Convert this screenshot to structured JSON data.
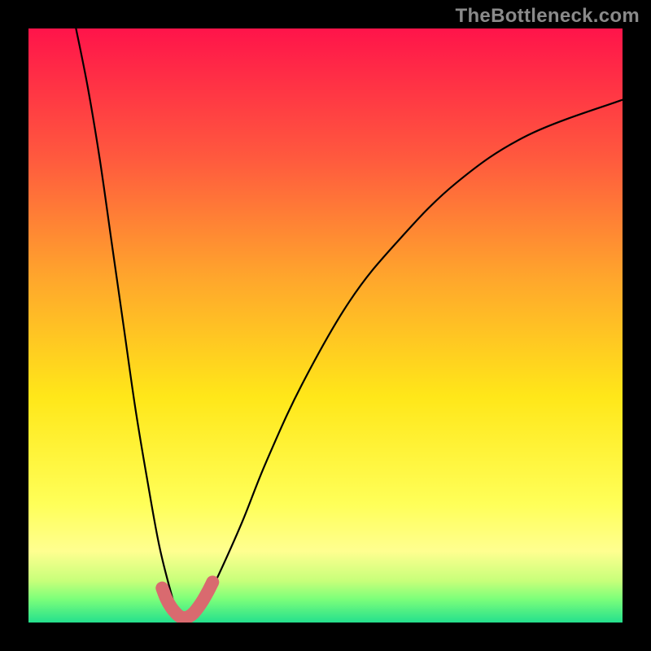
{
  "watermark": {
    "text": "TheBottleneck.com"
  },
  "chart_data": {
    "type": "line",
    "title": "",
    "xlabel": "",
    "ylabel": "",
    "xlim": [
      0,
      100
    ],
    "ylim": [
      0,
      100
    ],
    "series": [
      {
        "name": "bottleneck-curve",
        "x": [
          8,
          10,
          12,
          14,
          16,
          18,
          20,
          22,
          24,
          25,
          26,
          27,
          28,
          29,
          30,
          32,
          36,
          40,
          46,
          54,
          62,
          72,
          84,
          100
        ],
        "y": [
          100,
          90,
          78,
          64,
          50,
          36,
          24,
          13,
          5,
          2,
          1,
          0.5,
          1,
          2,
          4,
          8,
          17,
          27,
          40,
          54,
          64,
          74,
          82,
          88
        ]
      },
      {
        "name": "bottom-marker",
        "x": [
          22.5,
          23.2,
          24.0,
          24.8,
          25.5,
          26.2,
          27.0,
          27.8,
          28.6,
          29.4,
          30.2,
          31.0
        ],
        "y": [
          5.8,
          4.0,
          2.6,
          1.6,
          1.0,
          0.8,
          1.0,
          1.6,
          2.6,
          3.8,
          5.2,
          6.8
        ],
        "style": "thick-red"
      }
    ],
    "background_gradient": [
      "#ff144a",
      "#ff5a3e",
      "#ffa62c",
      "#ffe719",
      "#ffff58",
      "#ffff90",
      "#c7ff7a",
      "#7dff7a",
      "#24e08d"
    ]
  }
}
